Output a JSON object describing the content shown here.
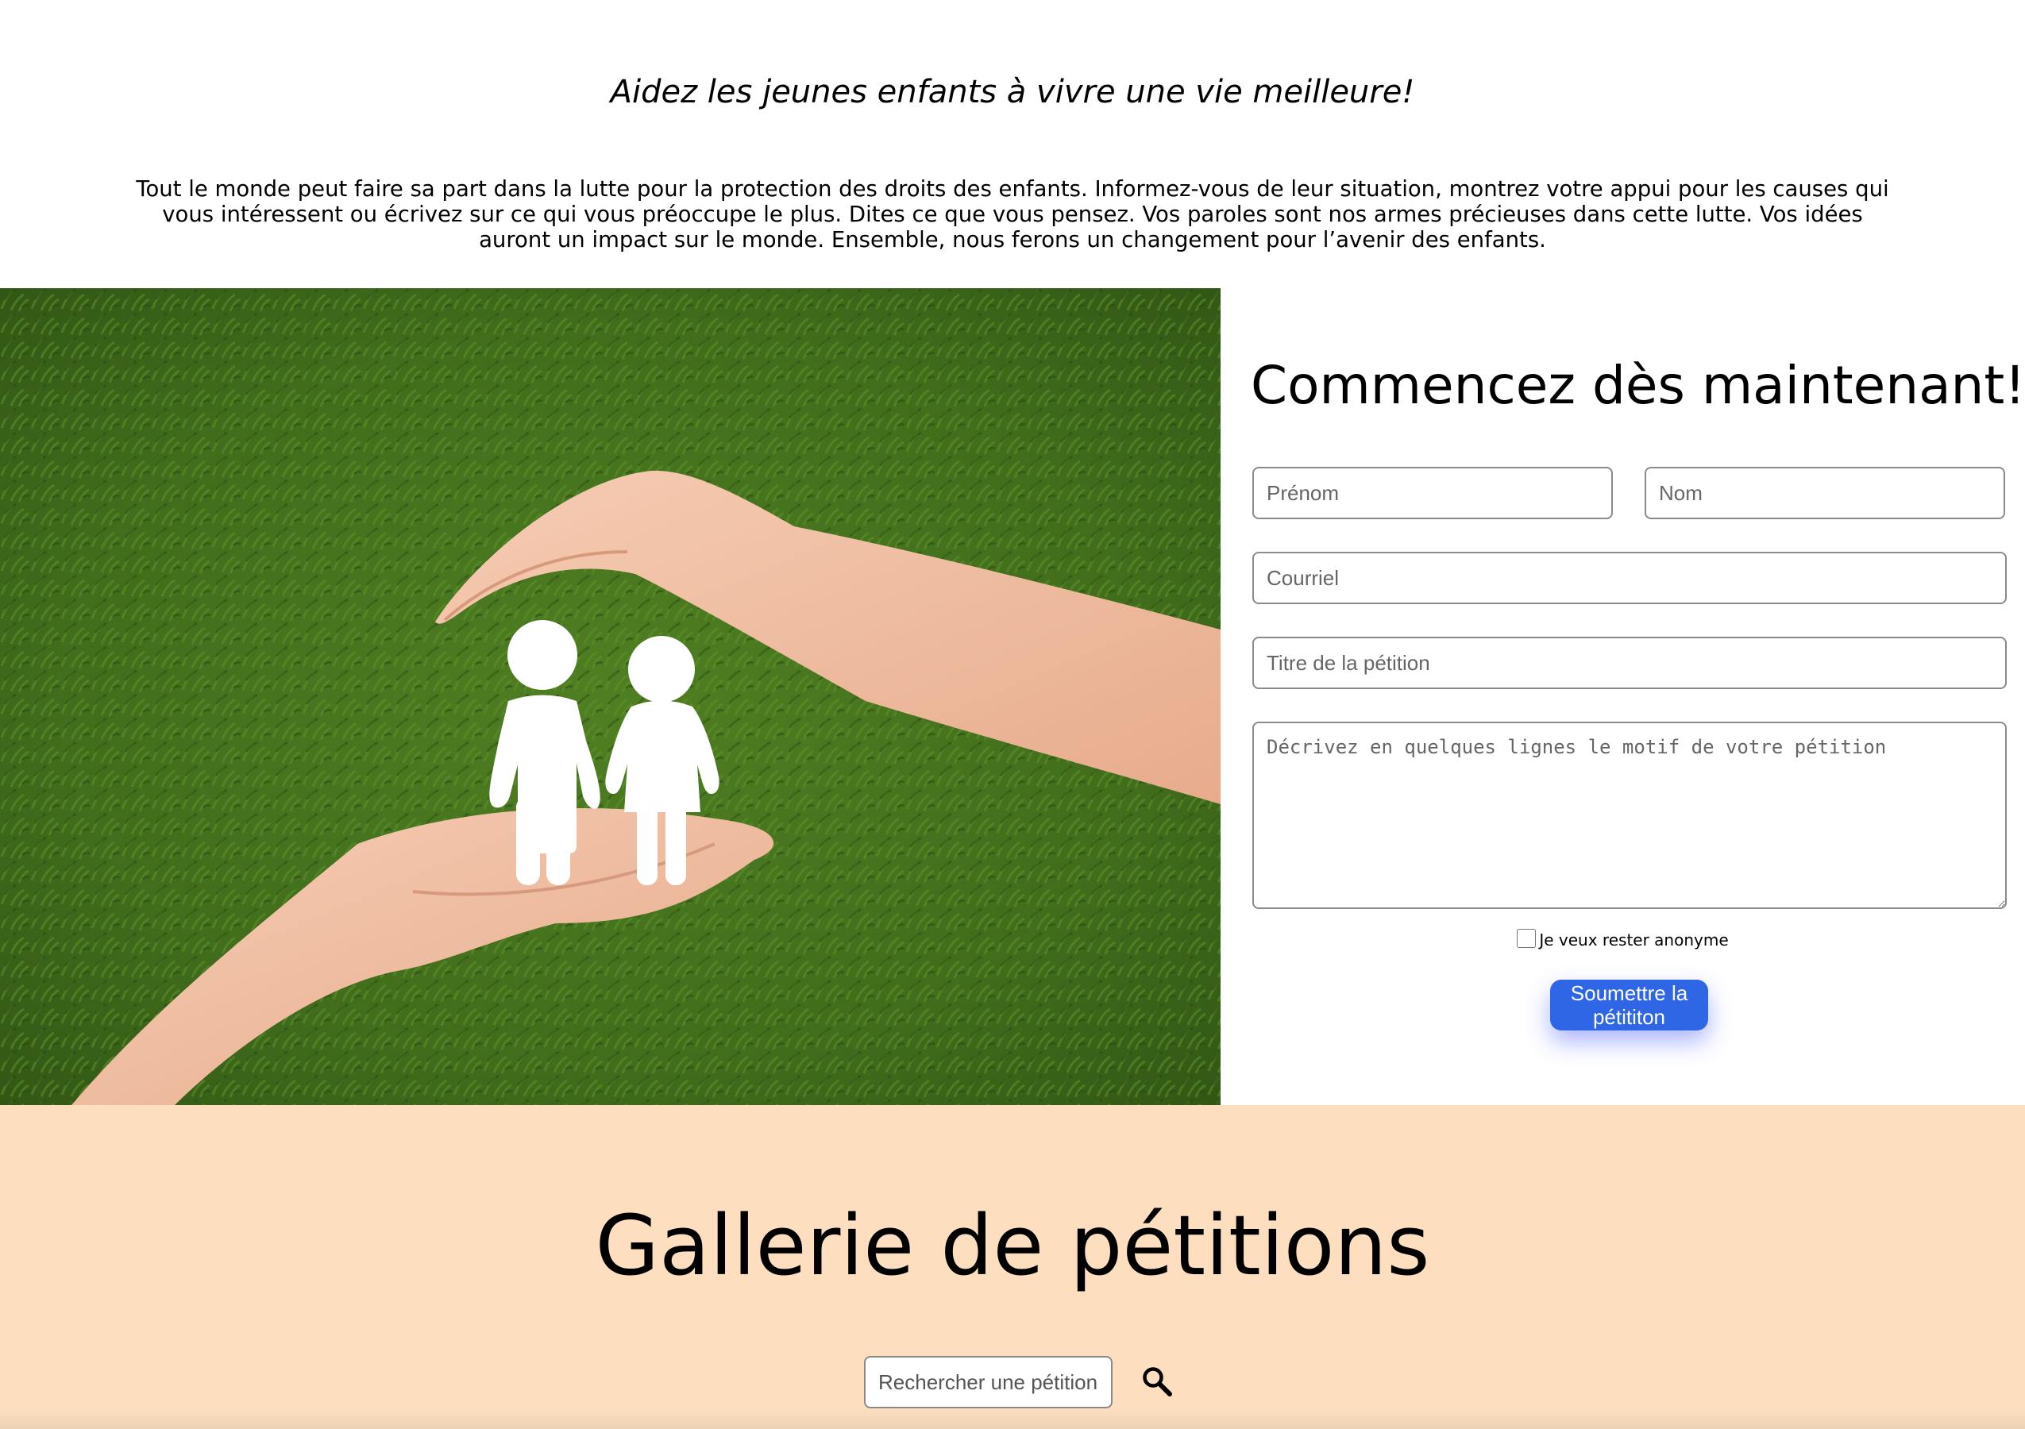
{
  "intro": {
    "tagline": "Aidez les jeunes enfants à vivre une vie meilleure!",
    "paragraph": "Tout le monde peut faire sa part dans la lutte pour la protection des droits des enfants. Informez-vous de leur situation, montrez votre appui pour les causes qui vous intéressent ou écrivez sur ce qui vous préoccupe le plus. Dites ce que vous pensez. Vos paroles sont nos armes précieuses dans cette lutte. Vos idées auront un impact sur le monde. Ensemble, nous ferons un changement pour l’avenir des enfants."
  },
  "hero": {
    "icons": [
      "hands-protecting-icon",
      "child-boy-icon",
      "child-girl-icon"
    ]
  },
  "form": {
    "title": "Commencez dès maintenant!",
    "first_name": {
      "placeholder": "Prénom",
      "value": ""
    },
    "last_name": {
      "placeholder": "Nom",
      "value": ""
    },
    "email": {
      "placeholder": "Courriel",
      "value": ""
    },
    "petition_title": {
      "placeholder": "Titre de la pétition",
      "value": ""
    },
    "description": {
      "placeholder": "Décrivez en quelques lignes le motif de votre pétition",
      "value": ""
    },
    "anonymous_label": "Je veux rester anonyme",
    "anonymous_checked": false,
    "submit_label": "Soumettre la pétititon",
    "accent_color": "#2f66e6"
  },
  "gallery": {
    "title": "Gallerie de pétitions",
    "search_placeholder": "Rechercher une pétition",
    "search_icon": "search-icon",
    "background_color": "#fddfc0"
  }
}
